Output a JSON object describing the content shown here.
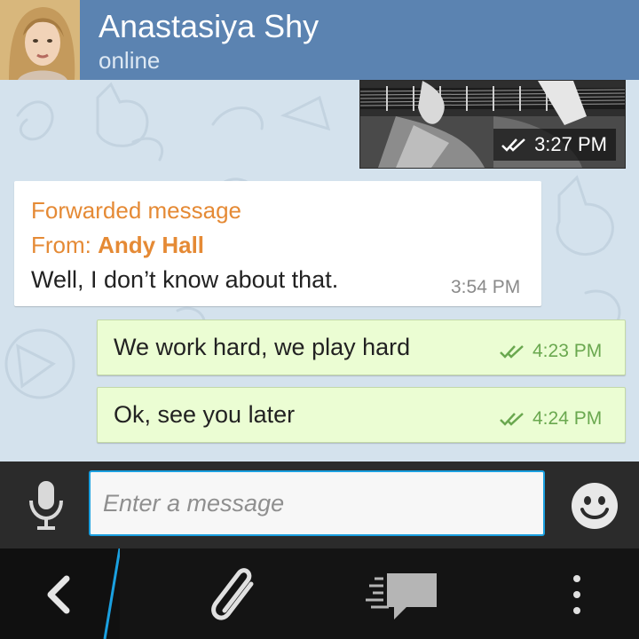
{
  "header": {
    "contact_name": "Anastasiya Shy",
    "status": "online",
    "bg_color": "#5b83b1"
  },
  "messages": [
    {
      "type": "photo",
      "direction": "out",
      "time": "3:27 PM",
      "read_icon": "double-check-icon"
    },
    {
      "type": "forwarded",
      "direction": "in",
      "forward_label": "Forwarded message",
      "from_prefix": "From: ",
      "from_name": "Andy Hall",
      "text": "Well, I don’t know about that.",
      "time": "3:54 PM"
    },
    {
      "type": "text",
      "direction": "out",
      "text": "We work hard, we play hard",
      "time": "4:23 PM",
      "read_icon": "double-check-icon"
    },
    {
      "type": "text",
      "direction": "out",
      "text": "Ok, see you later",
      "time": "4:24 PM",
      "read_icon": "double-check-icon"
    }
  ],
  "composer": {
    "placeholder": "Enter a message",
    "mic_icon": "microphone-icon",
    "emoji_icon": "smiley-icon",
    "accent_color": "#1aa0e0"
  },
  "action_bar": {
    "icons": [
      "back-icon",
      "paperclip-icon",
      "chat-bubble-icon",
      "overflow-menu-icon"
    ]
  },
  "colors": {
    "outgoing_bubble": "#ebfdd3",
    "incoming_bubble": "#ffffff",
    "forward_accent": "#e58a35",
    "read_check": "#6aa84f",
    "chat_bg": "#d4e2ed"
  }
}
